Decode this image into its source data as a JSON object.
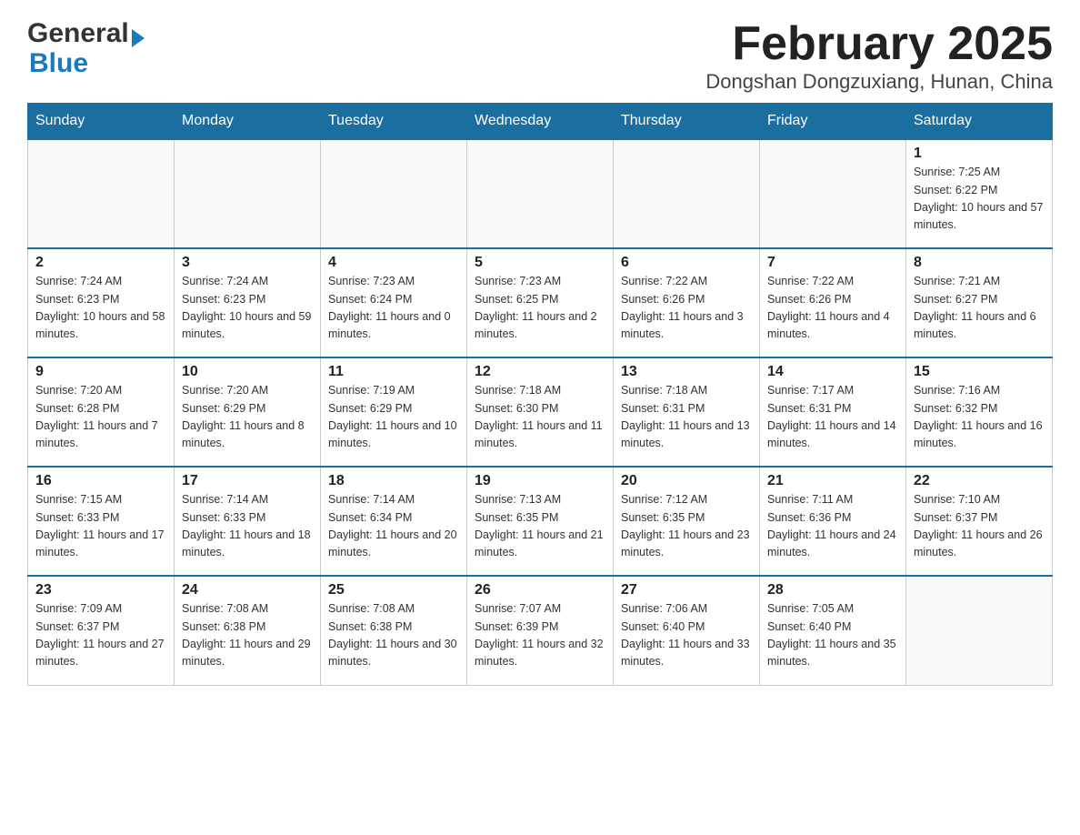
{
  "header": {
    "logo_general": "General",
    "logo_blue": "Blue",
    "month_title": "February 2025",
    "location": "Dongshan Dongzuxiang, Hunan, China"
  },
  "weekdays": [
    "Sunday",
    "Monday",
    "Tuesday",
    "Wednesday",
    "Thursday",
    "Friday",
    "Saturday"
  ],
  "weeks": [
    [
      {
        "day": "",
        "sunrise": "",
        "sunset": "",
        "daylight": ""
      },
      {
        "day": "",
        "sunrise": "",
        "sunset": "",
        "daylight": ""
      },
      {
        "day": "",
        "sunrise": "",
        "sunset": "",
        "daylight": ""
      },
      {
        "day": "",
        "sunrise": "",
        "sunset": "",
        "daylight": ""
      },
      {
        "day": "",
        "sunrise": "",
        "sunset": "",
        "daylight": ""
      },
      {
        "day": "",
        "sunrise": "",
        "sunset": "",
        "daylight": ""
      },
      {
        "day": "1",
        "sunrise": "Sunrise: 7:25 AM",
        "sunset": "Sunset: 6:22 PM",
        "daylight": "Daylight: 10 hours and 57 minutes."
      }
    ],
    [
      {
        "day": "2",
        "sunrise": "Sunrise: 7:24 AM",
        "sunset": "Sunset: 6:23 PM",
        "daylight": "Daylight: 10 hours and 58 minutes."
      },
      {
        "day": "3",
        "sunrise": "Sunrise: 7:24 AM",
        "sunset": "Sunset: 6:23 PM",
        "daylight": "Daylight: 10 hours and 59 minutes."
      },
      {
        "day": "4",
        "sunrise": "Sunrise: 7:23 AM",
        "sunset": "Sunset: 6:24 PM",
        "daylight": "Daylight: 11 hours and 0 minutes."
      },
      {
        "day": "5",
        "sunrise": "Sunrise: 7:23 AM",
        "sunset": "Sunset: 6:25 PM",
        "daylight": "Daylight: 11 hours and 2 minutes."
      },
      {
        "day": "6",
        "sunrise": "Sunrise: 7:22 AM",
        "sunset": "Sunset: 6:26 PM",
        "daylight": "Daylight: 11 hours and 3 minutes."
      },
      {
        "day": "7",
        "sunrise": "Sunrise: 7:22 AM",
        "sunset": "Sunset: 6:26 PM",
        "daylight": "Daylight: 11 hours and 4 minutes."
      },
      {
        "day": "8",
        "sunrise": "Sunrise: 7:21 AM",
        "sunset": "Sunset: 6:27 PM",
        "daylight": "Daylight: 11 hours and 6 minutes."
      }
    ],
    [
      {
        "day": "9",
        "sunrise": "Sunrise: 7:20 AM",
        "sunset": "Sunset: 6:28 PM",
        "daylight": "Daylight: 11 hours and 7 minutes."
      },
      {
        "day": "10",
        "sunrise": "Sunrise: 7:20 AM",
        "sunset": "Sunset: 6:29 PM",
        "daylight": "Daylight: 11 hours and 8 minutes."
      },
      {
        "day": "11",
        "sunrise": "Sunrise: 7:19 AM",
        "sunset": "Sunset: 6:29 PM",
        "daylight": "Daylight: 11 hours and 10 minutes."
      },
      {
        "day": "12",
        "sunrise": "Sunrise: 7:18 AM",
        "sunset": "Sunset: 6:30 PM",
        "daylight": "Daylight: 11 hours and 11 minutes."
      },
      {
        "day": "13",
        "sunrise": "Sunrise: 7:18 AM",
        "sunset": "Sunset: 6:31 PM",
        "daylight": "Daylight: 11 hours and 13 minutes."
      },
      {
        "day": "14",
        "sunrise": "Sunrise: 7:17 AM",
        "sunset": "Sunset: 6:31 PM",
        "daylight": "Daylight: 11 hours and 14 minutes."
      },
      {
        "day": "15",
        "sunrise": "Sunrise: 7:16 AM",
        "sunset": "Sunset: 6:32 PM",
        "daylight": "Daylight: 11 hours and 16 minutes."
      }
    ],
    [
      {
        "day": "16",
        "sunrise": "Sunrise: 7:15 AM",
        "sunset": "Sunset: 6:33 PM",
        "daylight": "Daylight: 11 hours and 17 minutes."
      },
      {
        "day": "17",
        "sunrise": "Sunrise: 7:14 AM",
        "sunset": "Sunset: 6:33 PM",
        "daylight": "Daylight: 11 hours and 18 minutes."
      },
      {
        "day": "18",
        "sunrise": "Sunrise: 7:14 AM",
        "sunset": "Sunset: 6:34 PM",
        "daylight": "Daylight: 11 hours and 20 minutes."
      },
      {
        "day": "19",
        "sunrise": "Sunrise: 7:13 AM",
        "sunset": "Sunset: 6:35 PM",
        "daylight": "Daylight: 11 hours and 21 minutes."
      },
      {
        "day": "20",
        "sunrise": "Sunrise: 7:12 AM",
        "sunset": "Sunset: 6:35 PM",
        "daylight": "Daylight: 11 hours and 23 minutes."
      },
      {
        "day": "21",
        "sunrise": "Sunrise: 7:11 AM",
        "sunset": "Sunset: 6:36 PM",
        "daylight": "Daylight: 11 hours and 24 minutes."
      },
      {
        "day": "22",
        "sunrise": "Sunrise: 7:10 AM",
        "sunset": "Sunset: 6:37 PM",
        "daylight": "Daylight: 11 hours and 26 minutes."
      }
    ],
    [
      {
        "day": "23",
        "sunrise": "Sunrise: 7:09 AM",
        "sunset": "Sunset: 6:37 PM",
        "daylight": "Daylight: 11 hours and 27 minutes."
      },
      {
        "day": "24",
        "sunrise": "Sunrise: 7:08 AM",
        "sunset": "Sunset: 6:38 PM",
        "daylight": "Daylight: 11 hours and 29 minutes."
      },
      {
        "day": "25",
        "sunrise": "Sunrise: 7:08 AM",
        "sunset": "Sunset: 6:38 PM",
        "daylight": "Daylight: 11 hours and 30 minutes."
      },
      {
        "day": "26",
        "sunrise": "Sunrise: 7:07 AM",
        "sunset": "Sunset: 6:39 PM",
        "daylight": "Daylight: 11 hours and 32 minutes."
      },
      {
        "day": "27",
        "sunrise": "Sunrise: 7:06 AM",
        "sunset": "Sunset: 6:40 PM",
        "daylight": "Daylight: 11 hours and 33 minutes."
      },
      {
        "day": "28",
        "sunrise": "Sunrise: 7:05 AM",
        "sunset": "Sunset: 6:40 PM",
        "daylight": "Daylight: 11 hours and 35 minutes."
      },
      {
        "day": "",
        "sunrise": "",
        "sunset": "",
        "daylight": ""
      }
    ]
  ]
}
